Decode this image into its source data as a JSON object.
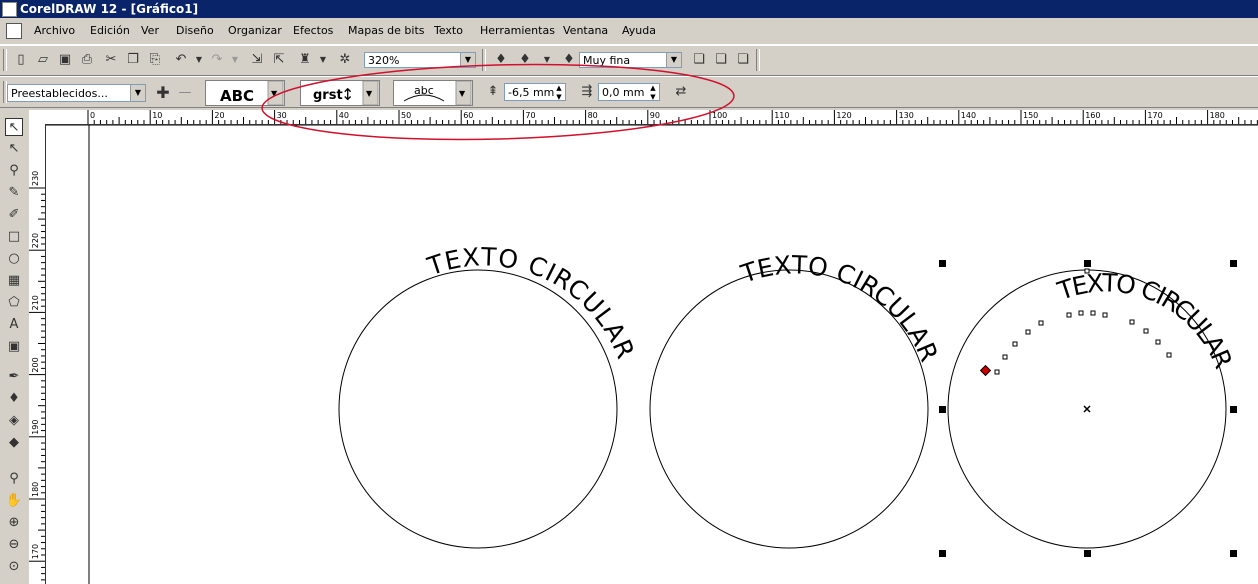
{
  "window": {
    "title": "CorelDRAW 12 - [Gráfico1]"
  },
  "menu": {
    "items": [
      "Archivo",
      "Edición",
      "Ver",
      "Diseño",
      "Organizar",
      "Efectos",
      "Mapas de bits",
      "Texto",
      "Herramientas",
      "Ventana",
      "Ayuda"
    ]
  },
  "standard_toolbar": {
    "zoom_value": "320%",
    "outline_width_value": "Muy fina"
  },
  "property_bar": {
    "presets_value": "Preestablecidos...",
    "text_style_preview": "ABC",
    "orientation_preview": "grst",
    "text_placement_preview": "abc",
    "distance_from_path_value": "-6,5 mm",
    "horizontal_offset_value": "0,0 mm"
  },
  "rulers": {
    "horizontal_labels": [
      "0",
      "10",
      "20",
      "30",
      "40",
      "50",
      "60",
      "70",
      "80",
      "90",
      "100",
      "110",
      "120",
      "130",
      "140",
      "150",
      "160",
      "170",
      "180"
    ],
    "vertical_labels": [
      "230",
      "220",
      "210",
      "200",
      "190",
      "180",
      "170"
    ]
  },
  "canvas": {
    "objects": [
      {
        "name": "text-on-circle-1",
        "text": "TEXTO CIRCULAR"
      },
      {
        "name": "text-on-circle-2",
        "text": "TEXTO CIRCULAR"
      },
      {
        "name": "text-on-circle-3-selected",
        "text": "TEXTO CIRCULAR"
      }
    ]
  },
  "colors": {
    "titlebar": "#0a246a",
    "annotation_ellipse": "#d0102c",
    "node_marker": "#cc0000",
    "workspace": "#d4d0c8"
  }
}
